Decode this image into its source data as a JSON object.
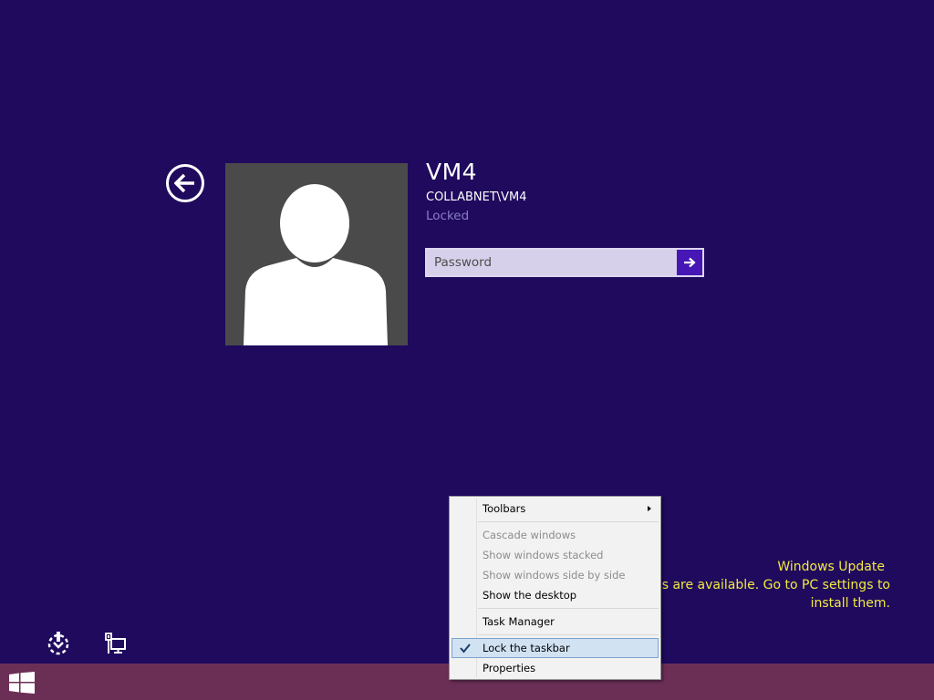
{
  "lock_screen": {
    "back_button_icon": "back-arrow-icon",
    "avatar_icon": "user-silhouette-icon",
    "user_name": "VM4",
    "user_domain": "COLLABNET\\VM4",
    "user_status": "Locked",
    "password_placeholder": "Password",
    "password_value": "",
    "submit_icon": "arrow-right-icon",
    "background_color": "#1f0a5e",
    "accent_color": "#4617b4"
  },
  "notification": {
    "title": "Windows Update",
    "line1": "ates are available. Go to PC settings to",
    "line2": "install them.",
    "text_color": "#f2ea3f"
  },
  "bottom_icons": {
    "ease_of_access_icon": "ease-of-access-icon",
    "network_icon": "network-icon"
  },
  "taskbar": {
    "start_icon": "windows-logo-icon",
    "color": "#6b2f56"
  },
  "context_menu": {
    "toolbars": "Toolbars",
    "cascade": "Cascade windows",
    "stacked": "Show windows stacked",
    "side_by_side": "Show windows side by side",
    "show_desktop": "Show the desktop",
    "task_manager": "Task Manager",
    "lock_taskbar": "Lock the taskbar",
    "lock_taskbar_checked": true,
    "properties": "Properties"
  }
}
